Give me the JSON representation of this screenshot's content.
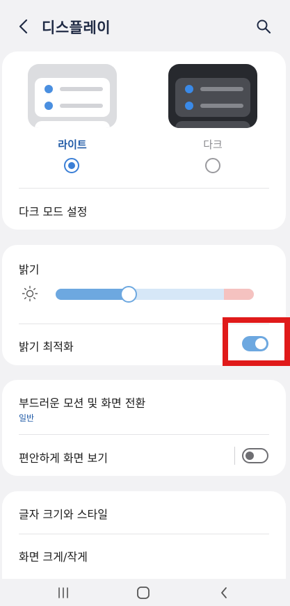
{
  "header": {
    "title": "디스플레이",
    "back_icon": "chevron-left-icon",
    "search_icon": "search-icon"
  },
  "theme": {
    "light_label": "라이트",
    "dark_label": "다크",
    "selected": "light",
    "dark_mode_settings_label": "다크 모드 설정"
  },
  "brightness": {
    "label": "밝기",
    "level_percent": 37,
    "icon": "sun-icon",
    "adaptive_label": "밝기 최적화",
    "adaptive_on": true
  },
  "motion": {
    "label": "부드러운 모션 및 화면 전환",
    "value": "일반",
    "eye_comfort_label": "편안하게 화면 보기",
    "eye_comfort_on": false
  },
  "font": {
    "label": "글자 크기와 스타일",
    "zoom_label": "화면 크게/작게"
  },
  "colors": {
    "accent": "#6da8e0",
    "selected_text": "#1f5aa6",
    "highlight": "#e01a1a"
  },
  "navbar": {
    "recents_icon": "recents-icon",
    "home_icon": "home-icon",
    "back_icon": "back-icon"
  }
}
